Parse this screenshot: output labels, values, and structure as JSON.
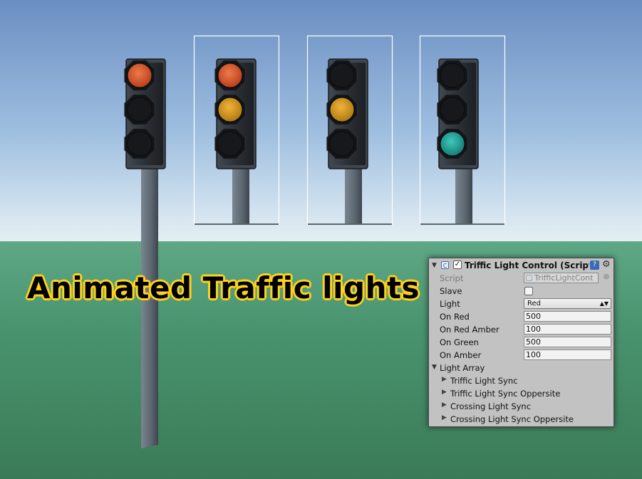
{
  "headline": "Animated Traffic lights",
  "colors": {
    "sky_top": "#6b8ec2",
    "sky_bottom": "#e4eef4",
    "ground_top": "#5da786",
    "ground_bottom": "#3b7c55",
    "housing": "#2c3036",
    "pole": "#5c6670",
    "red_on": "#d8542a",
    "amber_on": "#d59a22",
    "green_on": "#1ea59a",
    "lamp_off": "#15171a",
    "headline_text": "#000000",
    "headline_outline": "#ffd21a"
  },
  "traffic_lights": [
    {
      "name": "left",
      "state": "red",
      "selected": false
    },
    {
      "name": "second",
      "state": "red-amber",
      "selected": true
    },
    {
      "name": "third",
      "state": "amber",
      "selected": true
    },
    {
      "name": "fourth",
      "state": "green",
      "selected": true
    }
  ],
  "inspector": {
    "title": "Triffic Light Control (Script",
    "enabled": true,
    "script_label": "Script",
    "script_value": "TrifficLightCont",
    "slave_label": "Slave",
    "slave_checked": false,
    "light_label": "Light",
    "light_value": "Red",
    "fields": [
      {
        "label": "On Red",
        "value": "500"
      },
      {
        "label": "On Red Amber",
        "value": "100"
      },
      {
        "label": "On Green",
        "value": "500"
      },
      {
        "label": "On Amber",
        "value": "100"
      }
    ],
    "array_label": "Light Array",
    "array_items": [
      "Triffic Light Sync",
      "Triffic Light Sync Oppersite",
      "Crossing Light Sync",
      "Crossing Light Sync Oppersite"
    ]
  }
}
